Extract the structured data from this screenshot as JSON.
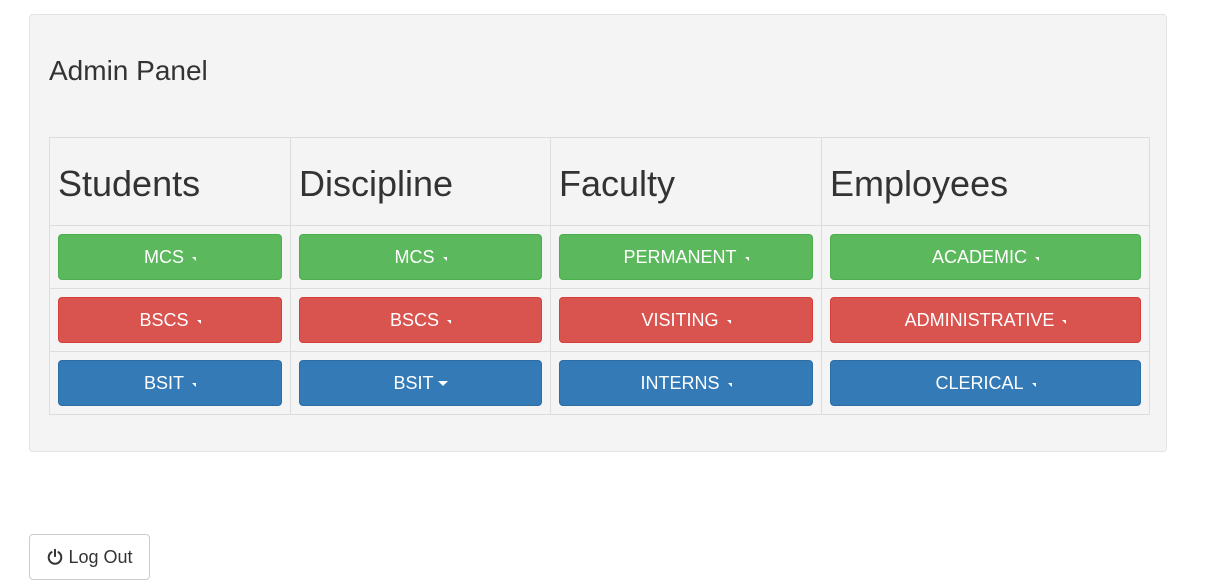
{
  "panel": {
    "title": "Admin Panel"
  },
  "columns": [
    {
      "header": "Students",
      "buttons": [
        {
          "label": "MCS",
          "color": "#5cb85c"
        },
        {
          "label": "BSCS",
          "color": "#d9534f"
        },
        {
          "label": "BSIT",
          "color": "#337ab7"
        }
      ]
    },
    {
      "header": "Discipline",
      "buttons": [
        {
          "label": "MCS",
          "color": "#5cb85c"
        },
        {
          "label": "BSCS",
          "color": "#d9534f"
        },
        {
          "label": "BSIT",
          "color": "#337ab7"
        }
      ]
    },
    {
      "header": "Faculty",
      "buttons": [
        {
          "label": "PERMANENT",
          "color": "#5cb85c"
        },
        {
          "label": "VISITING",
          "color": "#d9534f"
        },
        {
          "label": "INTERNS",
          "color": "#337ab7"
        }
      ]
    },
    {
      "header": "Employees",
      "buttons": [
        {
          "label": "ACADEMIC",
          "color": "#5cb85c"
        },
        {
          "label": "ADMINISTRATIVE",
          "color": "#d9534f"
        },
        {
          "label": "CLERICAL",
          "color": "#337ab7"
        }
      ]
    }
  ],
  "logout": {
    "label": "Log Out",
    "icon": "power-icon"
  }
}
